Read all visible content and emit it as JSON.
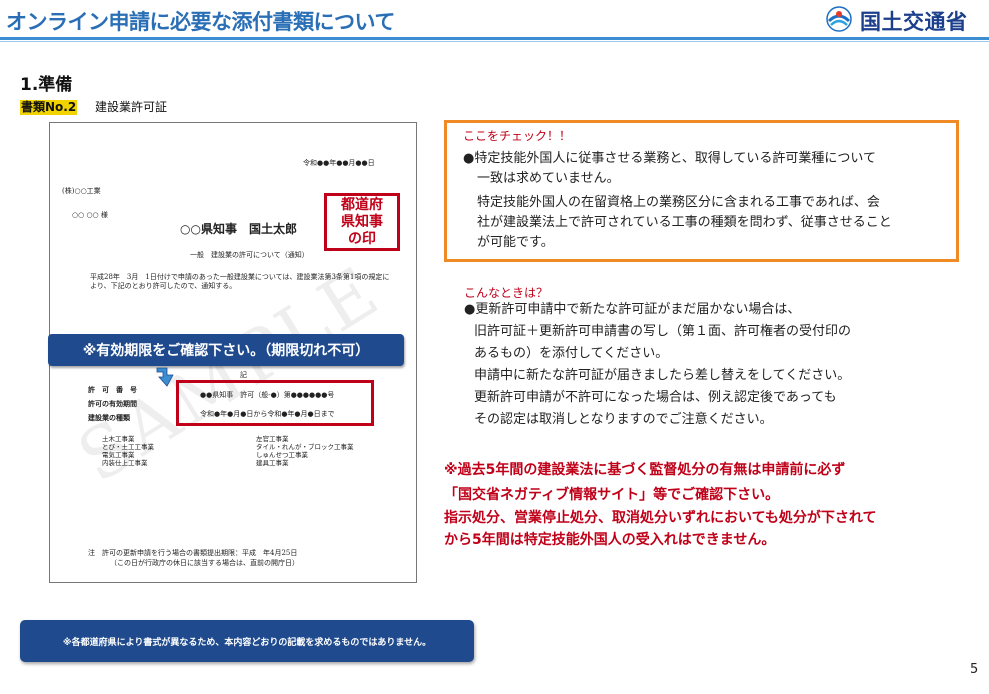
{
  "header": {
    "title": "オンライン申請に必要な添付書類について",
    "logo_text": "国土交通省",
    "logo_icon": "mlit-logo-icon"
  },
  "section": {
    "title": "1.準備",
    "doc_tag": "書類No.2",
    "doc_name": "建設業許可証"
  },
  "certificate": {
    "date": "令和●●年●●月●●日",
    "corp": "(株)○○工業",
    "name": "○○ ○○ 様",
    "governor": "○○県知事　国土太郎",
    "kind": "一般　建設業の許可について（通知）",
    "body": "平成28年　3月　1日付けで申請のあった一般建設業については、建設業法第3条第1項の規定により、下記のとおり許可したので、通知する。",
    "ki": "記",
    "labels": [
      "許　可　番　号",
      "許可の有効期間",
      "建設業の種類"
    ],
    "permit_number": "●●県知事　許可（般-●）第●●●●●●号",
    "validity": "令和●年●月●日から令和●年●月●日まで",
    "businesses_left": [
      "土木工事業",
      "とび・土工工事業",
      "電気工事業",
      "内装仕上工事業"
    ],
    "businesses_right": [
      "左官工事業",
      "タイル・れんが・ブロック工事業",
      "しゅんせつ工事業",
      "建具工事業"
    ],
    "note1": "注　許可の更新申請を行う場合の書類提出期限：平成　年4月25日",
    "note2": "（この日が行政庁の休日に該当する場合は、直前の開庁日）",
    "watermark": "SAMPLE",
    "seal": "都道府\n県知事\nの印"
  },
  "expiry_banner": "※有効期限をご確認下さい。（期限切れ不可）",
  "check": {
    "title": "ここをチェック！！",
    "lines": [
      "●特定技能外国人に従事させる業務と、取得している許可業種について",
      "一致は求めていません。",
      "特定技能外国人の在留資格上の業務区分に含まれる工事であれば、会",
      "社が建設業法上で許可されている工事の種類を問わず、従事させること",
      "が可能です。"
    ]
  },
  "when": {
    "title": "こんなときは？",
    "lines": [
      "●更新許可申請中で新たな許可証がまだ届かない場合は、",
      "旧許可証＋更新許可申請書の写し（第１面、許可権者の受付印の",
      "あるもの）を添付してください。",
      "申請中に新たな許可証が届きましたら差し替えをしてください。",
      "更新許可申請が不許可になった場合は、例え認定後であっても",
      "その認定は取消しとなりますのでご注意ください。"
    ]
  },
  "warning": {
    "lines": [
      "※過去5年間の建設業法に基づく監督処分の有無は申請前に必ず",
      "「国交省ネガティブ情報サイト」等でご確認下さい。",
      "指示処分、営業停止処分、取消処分いずれにおいても処分が下されて",
      "から5年間は特定技能外国人の受入れはできません。"
    ]
  },
  "bottom_banner": "※各都道府県により書式が異なるため、本内容どおりの記載を求めるものではありません。",
  "page_number": "5",
  "colors": {
    "title_blue": "#2a6fb5",
    "banner_navy": "#1f4b8e",
    "alert_red": "#c00018",
    "check_orange": "#f08a24",
    "tag_yellow": "#f1d300"
  }
}
